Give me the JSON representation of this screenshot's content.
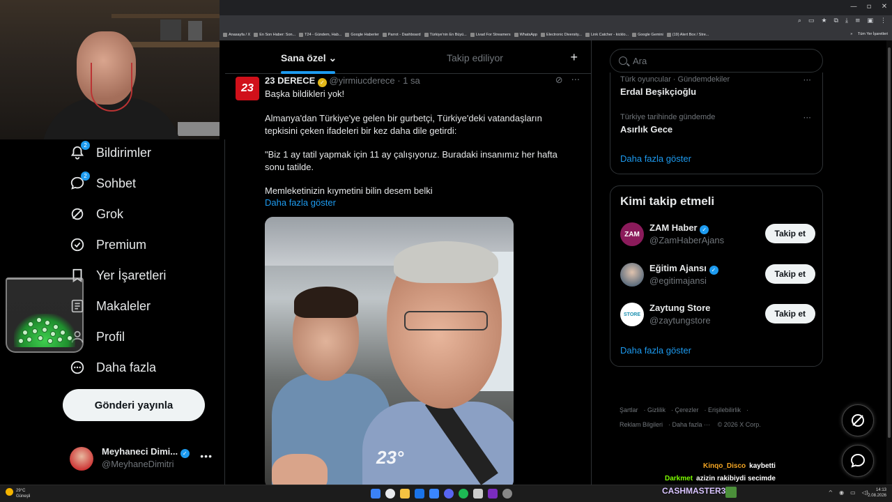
{
  "browser": {
    "window_controls": [
      "—",
      "▫",
      "✕"
    ],
    "bookmarks": [
      "Anasayfa / X",
      "En Son Haber: Son...",
      "T24 - Gündem, Hab...",
      "Google Haberler",
      "Parrot - Dashboard",
      "Türkiye'nin En Büyü...",
      "Livad For Streamers",
      "WhatsApp",
      "Electronic Diversity...",
      "Link Catcher - kicklo...",
      "Google Gemini",
      "(19) Alert Box / Stre..."
    ],
    "bookmarks_more": "»",
    "all_bookmarks": "Tüm Yer İşaretleri"
  },
  "sidebar": {
    "items": [
      {
        "label": "Bildirimler",
        "icon": "bell-icon",
        "badge": "2",
        "glyph": "🔔"
      },
      {
        "label": "Sohbet",
        "icon": "chat-icon",
        "badge": "2",
        "glyph": "💬"
      },
      {
        "label": "Grok",
        "icon": "grok-icon",
        "badge": null,
        "glyph": "⊘"
      },
      {
        "label": "Premium",
        "icon": "premium-icon",
        "badge": null,
        "glyph": "✓"
      },
      {
        "label": "Yer İşaretleri",
        "icon": "bookmark-icon",
        "badge": null,
        "glyph": "🔖"
      },
      {
        "label": "Makaleler",
        "icon": "articles-icon",
        "badge": null,
        "glyph": "📄"
      },
      {
        "label": "Profil",
        "icon": "profile-icon",
        "badge": null,
        "glyph": "👤"
      },
      {
        "label": "Daha fazla",
        "icon": "more-circle-icon",
        "badge": null,
        "glyph": "⋯"
      }
    ],
    "post_button": "Gönderi yayınla",
    "profile": {
      "name": "Meyhaneci Dimi...",
      "handle": "@MeyhaneDimitri",
      "more": "•••"
    }
  },
  "feed": {
    "tabs": [
      {
        "label": "Sana özel",
        "active": true
      },
      {
        "label": "Takip ediliyor",
        "active": false
      }
    ],
    "tab_chevron": "⌄",
    "add_tab": "+",
    "tweet": {
      "avatar_text": "23",
      "name": "23 DERECE",
      "handle": "@yirmiucderece · 1 sa",
      "text_1": "Başka bildikleri yok!",
      "text_2": "Almanya'dan Türkiye'ye gelen bir gurbetçi, Türkiye'deki vatandaşların tepkisini çeken ifadeleri bir kez daha dile getirdi:",
      "text_3": "\"Biz 1 ay tatil yapmak için 11 ay çalışıyoruz. Buradaki insanımız her hafta sonu tatilde.",
      "text_4": "Memleketinizin kıymetini bilin desem belki",
      "show_more": "Daha fazla göster",
      "media_watermark": "23°"
    }
  },
  "right": {
    "search_placeholder": "Ara",
    "trends": [
      {
        "meta": "Türk oyuncular · Gündemdekiler",
        "name": "Erdal Beşikçioğlu"
      },
      {
        "meta": "Türkiye tarihinde gündemde",
        "name": "Asırlık Gece"
      }
    ],
    "trends_show_more": "Daha fazla göster",
    "who_to_follow": {
      "title": "Kimi takip etmeli",
      "accounts": [
        {
          "name": "ZAM Haber",
          "handle": "@ZamHaberAjans",
          "button": "Takip et",
          "avatar_text": "ZAM"
        },
        {
          "name": "Eğitim Ajansı",
          "handle": "@egitimajansi",
          "button": "Takip et",
          "avatar_text": ""
        },
        {
          "name": "Zaytung Store",
          "handle": "@zaytungstore",
          "button": "Takip et",
          "avatar_text": "STORE"
        }
      ],
      "show_more": "Daha fazla göster"
    },
    "footer": [
      "Şartlar",
      "Gizlilik",
      "Çerezler",
      "Erişilebilirlik",
      "Reklam Bilgileri",
      "Daha fazla ···",
      "© 2026 X Corp."
    ]
  },
  "chat_overlay": {
    "messages": [
      {
        "user": "Kinqo_Disco",
        "text": "kaybetti",
        "color": "#f5a623"
      },
      {
        "user": "Darkmet",
        "text": "azizin rakibiydi secimde",
        "color": "#7cfc00"
      }
    ],
    "banner": "CASHMASTER34"
  },
  "taskbar": {
    "weather_temp": "29°C",
    "weather_desc": "Güneşli",
    "time": "14:13",
    "date": "2.08.2026",
    "app_colors": [
      "#3b82f6",
      "#e8eaed",
      "#f5c242",
      "#1a73e8",
      "#3a86ff",
      "#5865f2",
      "#1db954",
      "#cccccc",
      "#7b2cbf",
      "#888888"
    ]
  }
}
